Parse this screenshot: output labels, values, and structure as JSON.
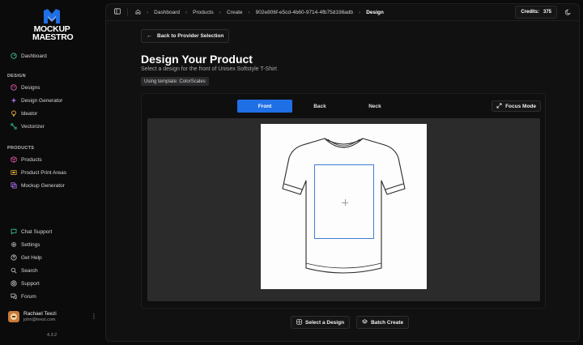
{
  "brand": {
    "line1": "MOCKUP",
    "line2": "MAESTRO",
    "accent": "#1f6fe5"
  },
  "sidebar": {
    "top_items": [
      {
        "label": "Dashboard",
        "icon": "gauge-icon"
      }
    ],
    "design_label": "DESIGN",
    "design_items": [
      {
        "label": "Designs",
        "icon": "palette-icon"
      },
      {
        "label": "Design Generator",
        "icon": "sparkles-icon"
      },
      {
        "label": "Ideator",
        "icon": "lightbulb-icon"
      },
      {
        "label": "Vectorizer",
        "icon": "vector-icon"
      }
    ],
    "products_label": "PRODUCTS",
    "product_items": [
      {
        "label": "Products",
        "icon": "box-icon"
      },
      {
        "label": "Product Print Areas",
        "icon": "print-area-icon"
      },
      {
        "label": "Mockup Generator",
        "icon": "mockup-icon"
      }
    ],
    "bottom_items": [
      {
        "label": "Chat Support",
        "icon": "chat-icon"
      },
      {
        "label": "Settings",
        "icon": "gear-icon"
      },
      {
        "label": "Get Help",
        "icon": "help-icon"
      },
      {
        "label": "Search",
        "icon": "search-icon"
      },
      {
        "label": "Support",
        "icon": "support-icon"
      },
      {
        "label": "Forum",
        "icon": "forum-icon"
      }
    ],
    "user": {
      "name": "Rachael Teezi",
      "email": "john@teezi.com"
    },
    "version": "4.3.2"
  },
  "breadcrumb": {
    "items": [
      "Dashboard",
      "Products",
      "Create",
      "902e806f-e5cd-4b60-9714-4fb75d198adb"
    ],
    "current": "Design"
  },
  "credits": {
    "label": "Credits:",
    "value": "375"
  },
  "page": {
    "back_label": "Back to Provider Selection",
    "title": "Design Your Product",
    "subtitle": "Select a design for the front of Unisex Softstyle T-Shirt",
    "template_badge": "Using template: ColorScales"
  },
  "editor": {
    "tabs": [
      {
        "label": "Front",
        "active": true
      },
      {
        "label": "Back",
        "active": false
      },
      {
        "label": "Neck",
        "active": false
      }
    ],
    "focus_mode_label": "Focus Mode"
  },
  "actions": {
    "select_design_label": "Select a Design",
    "batch_create_label": "Batch Create"
  }
}
